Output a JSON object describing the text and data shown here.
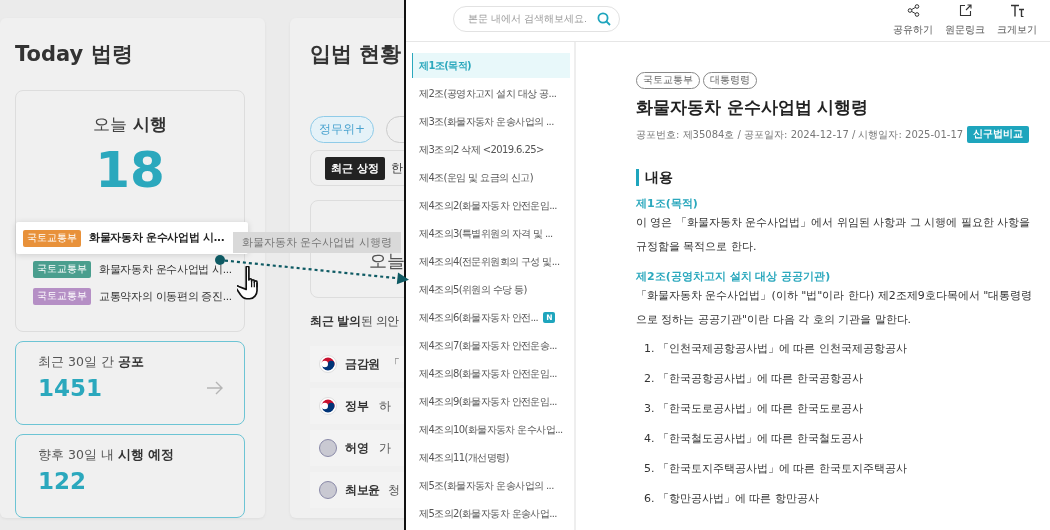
{
  "dashboard": {
    "today_card": {
      "title": "Today 법령",
      "today_label": "오늘 **시행**",
      "today_count": "18",
      "items": [
        {
          "ministry": "국토교통부",
          "color": "#e8913a",
          "title": "화물자동차 운수사업법 시...",
          "selected": true
        },
        {
          "ministry": "국토교통부",
          "color": "#4a9e8e",
          "title": "화물자동차 운수사업법 시...",
          "selected": false
        },
        {
          "ministry": "국토교통부",
          "color": "#b58fc5",
          "title": "교통약자의 이동편의 증진...",
          "selected": false
        }
      ],
      "stats": [
        {
          "label": "최근 30일 간 **공포**",
          "value": "1451",
          "has_arrow": true
        },
        {
          "label": "향후 30일 내 **시행 예정**",
          "value": "122",
          "has_arrow": false
        }
      ]
    },
    "legislation_card": {
      "title": "입법 현황",
      "chips": [
        {
          "label": "정무위+",
          "selected": true
        },
        {
          "selected": false
        }
      ],
      "recent_badge": "최근 상정",
      "recent_text": "한",
      "today_label": "오늘",
      "bills_title": "**최근 발의**된 의안",
      "bills": [
        {
          "kind": "emblem",
          "sponsor": "금감원",
          "summary": "「"
        },
        {
          "kind": "emblem",
          "sponsor": "정부",
          "summary": "하"
        },
        {
          "kind": "person",
          "sponsor": "허영",
          "summary": "가"
        },
        {
          "kind": "person",
          "sponsor": "최보윤",
          "summary": "청"
        }
      ]
    },
    "drag_tooltip": "화물자동차 운수사업법 시행령"
  },
  "viewer": {
    "search": {
      "placeholder": "본문 내에서 검색해보세요."
    },
    "actions": [
      {
        "kind": "share",
        "label": "공유하기"
      },
      {
        "kind": "link",
        "label": "원문링크"
      },
      {
        "kind": "font",
        "label": "크게보기"
      }
    ],
    "toc": [
      {
        "label": "제1조(목적)",
        "selected": true,
        "new": false
      },
      {
        "label": "제2조(공영차고지 설치 대상 공...",
        "selected": false,
        "new": false
      },
      {
        "label": "제3조(화물자동차 운송사업의 ...",
        "selected": false,
        "new": false
      },
      {
        "label": "제3조의2 삭제 <2019.6.25>",
        "selected": false,
        "new": false
      },
      {
        "label": "제4조(운임 및 요금의 신고)",
        "selected": false,
        "new": false
      },
      {
        "label": "제4조의2(화물자동차 안전운임...",
        "selected": false,
        "new": false
      },
      {
        "label": "제4조의3(특별위원의 자격 및 ...",
        "selected": false,
        "new": false
      },
      {
        "label": "제4조의4(전문위원회의 구성 및...",
        "selected": false,
        "new": false
      },
      {
        "label": "제4조의5(위원의 수당 등)",
        "selected": false,
        "new": false
      },
      {
        "label": "제4조의6(화물자동차 안전...",
        "selected": false,
        "new": true,
        "badge": "N"
      },
      {
        "label": "제4조의7(화물자동차 안전운송...",
        "selected": false,
        "new": false
      },
      {
        "label": "제4조의8(화물자동차 안전운임...",
        "selected": false,
        "new": false
      },
      {
        "label": "제4조의9(화물자동차 안전운임...",
        "selected": false,
        "new": false
      },
      {
        "label": "제4조의10(화물자동차 운수사업...",
        "selected": false,
        "new": false
      },
      {
        "label": "제4조의11(개선명령)",
        "selected": false,
        "new": false
      },
      {
        "label": "제5조(화물자동차 운송사업의 ...",
        "selected": false,
        "new": false
      },
      {
        "label": "제5조의2(화물자동차 운송사업...",
        "selected": false,
        "new": false
      }
    ],
    "document": {
      "tags": [
        "국토교통부",
        "대통령령"
      ],
      "title": "화물자동차 운수사업법 시행령",
      "meta": "공포번호: 제35084호 / 공포일자: 2024-12-17 / 시행일자: 2025-01-17",
      "compare_button": "신구법비교",
      "section_title": "내용",
      "articles": [
        {
          "heading": "제1조(목적)",
          "body": "이 영은 「화물자동차 운수사업법」에서 위임된 사항과 그 시행에 필요한 사항을 규정함을 목적으로 한다."
        },
        {
          "heading": "제2조(공영차고지 설치 대상 공공기관)",
          "body": "「화물자동차 운수사업법」(이하 \"법\"이라 한다) 제2조제9호다목에서 \"대통령령으로 정하는 공공기관\"이란 다음 각 호의 기관을 말한다.",
          "items": [
            "1. 「인천국제공항공사법」에 따른 인천국제공항공사",
            "2. 「한국공항공사법」에 따른 한국공항공사",
            "3. 「한국도로공사법」에 따른 한국도로공사",
            "4. 「한국철도공사법」에 따른 한국철도공사",
            "5. 「한국토지주택공사법」에 따른 한국토지주택공사",
            "6. 「항만공사법」에 따른 항만공사"
          ]
        }
      ]
    }
  }
}
